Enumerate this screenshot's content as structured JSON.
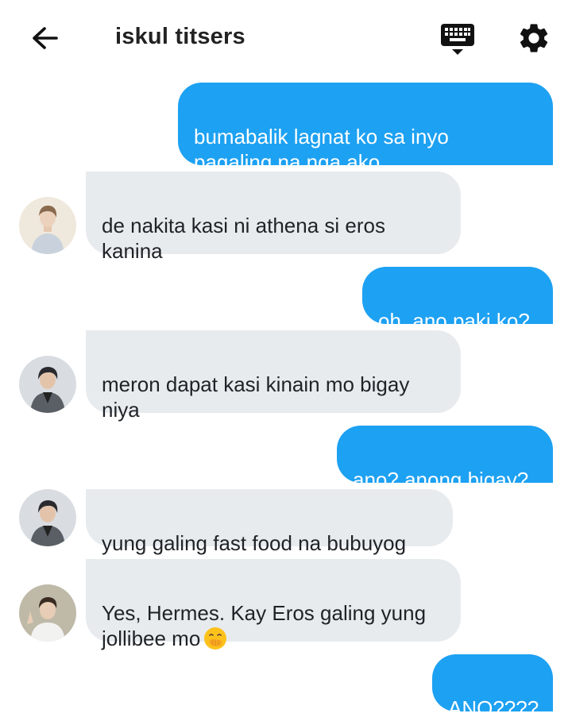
{
  "header": {
    "title": "iskul titsers",
    "back_icon": "arrow-left-icon",
    "keyboard_icon": "keyboard-icon",
    "settings_icon": "gear-icon"
  },
  "messages": [
    {
      "direction": "outgoing",
      "text": "bumabalik lagnat ko sa inyo\npagaling na nga ako"
    },
    {
      "direction": "incoming",
      "avatar": "avatar-1",
      "text": "de nakita kasi ni athena si eros\nkanina"
    },
    {
      "direction": "outgoing",
      "text": "oh, ano paki ko?"
    },
    {
      "direction": "incoming",
      "avatar": "avatar-2",
      "text": "meron dapat kasi kinain mo bigay\nniya"
    },
    {
      "direction": "outgoing",
      "text": "ano? anong bigay?"
    },
    {
      "direction": "incoming",
      "avatar": "avatar-2",
      "text": "yung galing fast food na bubuyog"
    },
    {
      "direction": "incoming",
      "avatar": "avatar-3",
      "text": "Yes, Hermes. Kay Eros galing yung\njollibee mo",
      "emoji": "face-with-hand-over-mouth"
    },
    {
      "direction": "outgoing",
      "text": "ANO????"
    }
  ],
  "colors": {
    "outgoing_bubble": "#1da1f2",
    "incoming_bubble": "#e8ebee",
    "header_text": "#222222"
  }
}
